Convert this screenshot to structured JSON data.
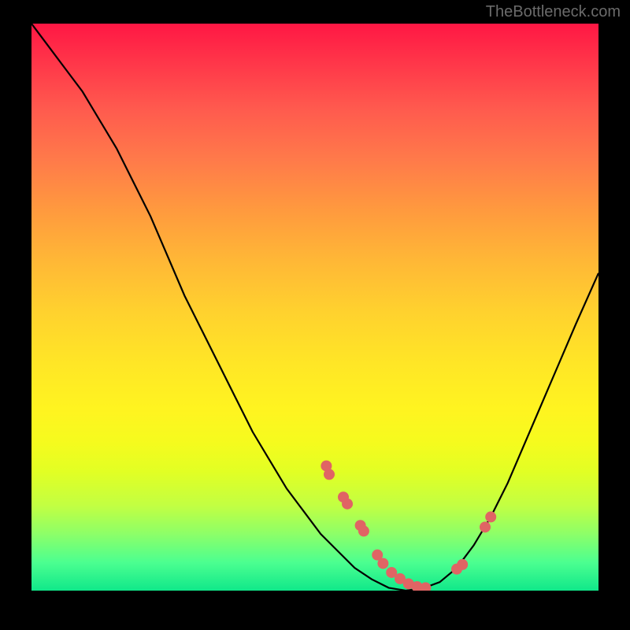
{
  "watermark": "TheBottleneck.com",
  "chart_data": {
    "type": "line",
    "title": "",
    "xlabel": "",
    "ylabel": "",
    "xlim": [
      0,
      100
    ],
    "ylim": [
      0,
      100
    ],
    "grid": false,
    "legend": false,
    "series": [
      {
        "name": "bottleneck-curve",
        "x": [
          0,
          3,
          6,
          9,
          12,
          15,
          18,
          21,
          24,
          27,
          30,
          33,
          36,
          39,
          42,
          45,
          48,
          51,
          54,
          57,
          60,
          63,
          66,
          69,
          72,
          75,
          78,
          81,
          84,
          87,
          90,
          93,
          96,
          100
        ],
        "y": [
          100,
          96,
          92,
          88,
          83,
          78,
          72,
          66,
          59,
          52,
          46,
          40,
          34,
          28,
          23,
          18,
          14,
          10,
          7,
          4,
          2,
          0.5,
          0,
          0.4,
          1.5,
          4,
          8,
          13,
          19,
          26,
          33,
          40,
          47,
          56
        ]
      }
    ],
    "scatter_points": {
      "name": "highlight-dots",
      "x": [
        52,
        52.5,
        55,
        55.7,
        58,
        58.6,
        61,
        62,
        63.5,
        65,
        66.5,
        68,
        69.5,
        75,
        76,
        80,
        81
      ],
      "y": [
        22,
        20.5,
        16.5,
        15.3,
        11.5,
        10.5,
        6.3,
        4.8,
        3.2,
        2.1,
        1.2,
        0.7,
        0.5,
        3.8,
        4.6,
        11.2,
        13
      ]
    }
  },
  "colors": {
    "dot_fill": "#e06464",
    "curve_stroke": "#000000",
    "gradient_top": "#ff1744",
    "gradient_bottom": "#10e88a"
  }
}
